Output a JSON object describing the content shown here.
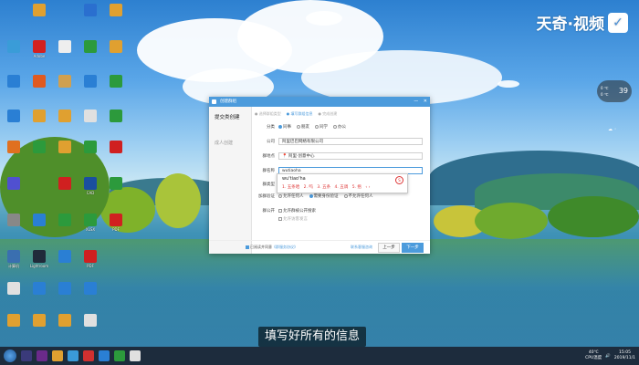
{
  "watermark": {
    "brand": "天奇·视频",
    "logo_glyph": "✓"
  },
  "weather": {
    "temp": "39",
    "line1": "0 ℃",
    "line2": "0 ℃"
  },
  "desktop_icons": [
    {
      "label": "",
      "color": "#e0a030"
    },
    {
      "label": "",
      "color": "#2a6fcf"
    },
    {
      "label": "",
      "color": "#e0a030"
    },
    {
      "label": "",
      "color": "#3a9cd8"
    },
    {
      "label": "Adobe",
      "color": "#d32020"
    },
    {
      "label": "",
      "color": "#eeeeee"
    },
    {
      "label": "",
      "color": "#2c9a3c"
    },
    {
      "label": "",
      "color": "#e0a030"
    },
    {
      "label": "",
      "color": "#2a7fd4"
    },
    {
      "label": "",
      "color": "#e05a20"
    },
    {
      "label": "",
      "color": "#d0a050"
    },
    {
      "label": "",
      "color": "#2a7fd4"
    },
    {
      "label": "",
      "color": "#2c9a3c"
    },
    {
      "label": "",
      "color": "#2a7fd4"
    },
    {
      "label": "",
      "color": "#e0a030"
    },
    {
      "label": "",
      "color": "#e0a030"
    },
    {
      "label": "",
      "color": "#e0e0e0"
    },
    {
      "label": "",
      "color": "#2c9a3c"
    },
    {
      "label": "",
      "color": "#e07020"
    },
    {
      "label": "",
      "color": "#2c9a3c"
    },
    {
      "label": "",
      "color": "#e0a030"
    },
    {
      "label": "",
      "color": "#2c9a3c"
    },
    {
      "label": "",
      "color": "#d02020"
    },
    {
      "label": "",
      "color": "#5050d0"
    },
    {
      "label": "",
      "color": "#d02020"
    },
    {
      "label": "CAD",
      "color": "#1a4fa0"
    },
    {
      "label": "",
      "color": "#2c9a3c"
    },
    {
      "label": "",
      "color": "#888888"
    },
    {
      "label": "",
      "color": "#2a7fd4"
    },
    {
      "label": "",
      "color": "#2c9a3c"
    },
    {
      "label": "XLSX",
      "color": "#2c9a3c"
    },
    {
      "label": "PDF",
      "color": "#d02020"
    },
    {
      "label": "计算机",
      "color": "#3a6fb0"
    },
    {
      "label": "Lightroom",
      "color": "#202a3a"
    },
    {
      "label": "",
      "color": "#2a7fd4"
    },
    {
      "label": "PDF",
      "color": "#d02020"
    },
    {
      "label": "",
      "color": "#e0e0e0"
    },
    {
      "label": "",
      "color": "#2a7fd4"
    },
    {
      "label": "",
      "color": "#2a7fd4"
    },
    {
      "label": "",
      "color": "#2a7fd4"
    },
    {
      "label": "",
      "color": "#e0a030"
    },
    {
      "label": "",
      "color": "#e0a030"
    },
    {
      "label": "",
      "color": "#e0a030"
    },
    {
      "label": "",
      "color": "#e0e0e0"
    }
  ],
  "dialog": {
    "title": "创建群组",
    "sidebar_heading": "提交类创建",
    "sidebar_sub": "成人创建",
    "steps": [
      "选择群组类型",
      "填写群组信息",
      "完成创建"
    ],
    "rows": {
      "category": {
        "label": "分类",
        "options": [
          "同事",
          "朋友",
          "同学",
          "办公"
        ],
        "selected": 0
      },
      "company": {
        "label": "公司",
        "value": "阿里巴巴网络有限公司"
      },
      "location": {
        "label": "群地点",
        "value": "📍 阿里·创意中心"
      },
      "group_name": {
        "label": "群名称",
        "value": "wutiaoha"
      },
      "group_type": {
        "label": "群类型"
      },
      "verify": {
        "label": "加群验证",
        "options": [
          "允许任何人",
          "需要身份验证",
          "不允许任何人"
        ],
        "selected": 1
      },
      "public": {
        "label": "群公开",
        "options": [
          "允许群被公开搜索",
          "允许访客发言"
        ]
      }
    },
    "ime": {
      "pinyin": "wu'tiao'ha",
      "candidates": [
        "1. 五条哈",
        "2. 呜",
        "3. 五条",
        "4. 五调",
        "5. 捂"
      ],
      "nav": "‹ ›"
    },
    "footer": {
      "agree_text": "已阅读并同意",
      "agree_link": "《群服务协议》",
      "hint": "联系客服咨询",
      "prev": "上一步",
      "next": "下一步"
    },
    "title_btns": [
      "—",
      "✕"
    ]
  },
  "subtitle": "填写好所有的信息",
  "taskbar": {
    "time": "15:05",
    "date": "2019/11/1",
    "cpu": "40℃",
    "cpu_label": "CPU温度"
  },
  "colors": {
    "accent": "#4c9bdc",
    "ime_red": "#d33333",
    "taskbar": "#1d2c3d"
  }
}
